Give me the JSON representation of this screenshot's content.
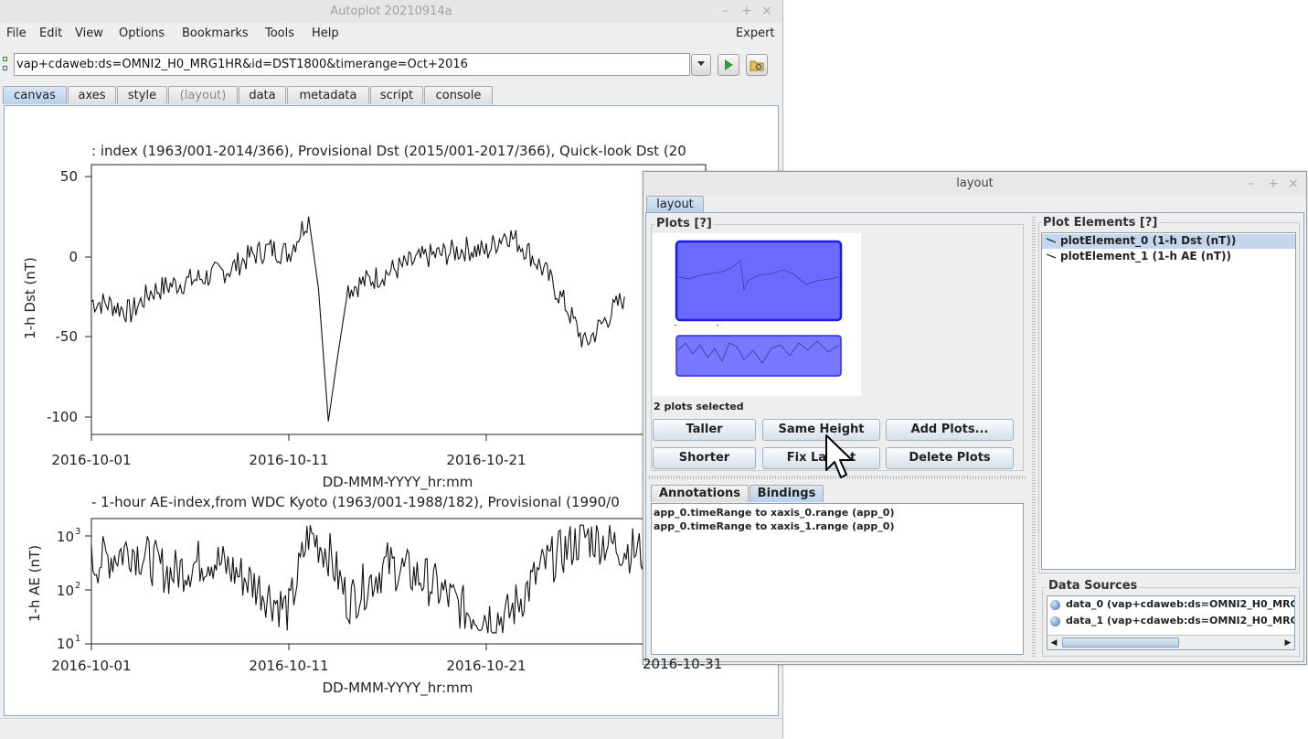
{
  "window": {
    "title": "Autoplot 20210914a",
    "controls": [
      "–",
      "+",
      "×"
    ]
  },
  "menu": {
    "items": [
      "File",
      "Edit",
      "View",
      "Options",
      "Bookmarks",
      "Tools",
      "Help"
    ],
    "expert": "Expert"
  },
  "uri": {
    "value": "vap+cdaweb:ds=OMNI2_H0_MRG1HR&id=DST1800&timerange=Oct+2016"
  },
  "tabs": [
    {
      "label": "canvas",
      "active": true
    },
    {
      "label": "axes"
    },
    {
      "label": "style"
    },
    {
      "label": "(layout)",
      "dim": true
    },
    {
      "label": "data"
    },
    {
      "label": "metadata"
    },
    {
      "label": "script"
    },
    {
      "label": "console"
    }
  ],
  "plots": [
    {
      "title": ": index (1963/001-2014/366), Provisional Dst (2015/001-2017/366), Quick-look Dst (20",
      "ylabel": "1-h Dst (nT)",
      "xlabel": "DD-MMM-YYYY_hr:mm",
      "yticks": [
        "50",
        "0",
        "-50",
        "-100"
      ],
      "xticks": [
        "2016-10-01",
        "2016-10-11",
        "2016-10-21"
      ]
    },
    {
      "title": "- 1-hour AE-index,from WDC Kyoto (1963/001-1988/182), Provisional (1990/0",
      "ylabel": "1-h AE (nT)",
      "xlabel": "DD-MMM-YYYY_hr:mm",
      "yticks": [
        "10",
        "10",
        "10"
      ],
      "yexp": [
        "3",
        "2",
        "1"
      ],
      "xticks": [
        "2016-10-01",
        "2016-10-11",
        "2016-10-21",
        "2016-10-31"
      ]
    }
  ],
  "chart_data": [
    {
      "type": "line",
      "title": ": index (1963/001-2014/366), Provisional Dst (2015/001-2017/366), Quick-look Dst (20",
      "xlabel": "DD-MMM-YYYY_hr:mm",
      "ylabel": "1-h Dst (nT)",
      "xlim": [
        "2016-10-01",
        "2016-10-28"
      ],
      "ylim": [
        -110,
        60
      ],
      "series": [
        {
          "x": [
            "2016-10-01",
            "2016-10-02",
            "2016-10-03",
            "2016-10-04",
            "2016-10-05",
            "2016-10-06",
            "2016-10-07",
            "2016-10-08",
            "2016-10-09",
            "2016-10-10",
            "2016-10-11",
            "2016-10-12",
            "2016-10-12.5",
            "2016-10-13",
            "2016-10-13.5",
            "2016-10-14",
            "2016-10-15",
            "2016-10-16",
            "2016-10-17",
            "2016-10-18",
            "2016-10-19",
            "2016-10-20",
            "2016-10-21",
            "2016-10-22",
            "2016-10-23",
            "2016-10-24",
            "2016-10-25",
            "2016-10-26",
            "2016-10-27",
            "2016-10-28"
          ],
          "y": [
            -28,
            -30,
            -35,
            -22,
            -18,
            -15,
            -12,
            -8,
            0,
            5,
            2,
            25,
            -20,
            -103,
            -60,
            -20,
            -15,
            -10,
            -5,
            0,
            2,
            5,
            3,
            15,
            5,
            -10,
            -30,
            -55,
            -40,
            -25
          ]
        }
      ]
    },
    {
      "type": "line",
      "title": "- 1-hour AE-index,from WDC Kyoto (1963/001-1988/182), Provisional (1990/0",
      "xlabel": "DD-MMM-YYYY_hr:mm",
      "ylabel": "1-h AE (nT)",
      "yscale": "log",
      "xlim": [
        "2016-10-01",
        "2016-10-31"
      ],
      "ylim": [
        10,
        1300
      ],
      "series": [
        {
          "x": [
            "2016-10-01",
            "2016-10-03",
            "2016-10-05",
            "2016-10-07",
            "2016-10-09",
            "2016-10-11",
            "2016-10-12",
            "2016-10-13",
            "2016-10-14",
            "2016-10-16",
            "2016-10-18",
            "2016-10-20",
            "2016-10-22",
            "2016-10-24",
            "2016-10-26",
            "2016-10-28",
            "2016-10-30"
          ],
          "y": [
            300,
            600,
            200,
            400,
            150,
            40,
            1100,
            500,
            60,
            300,
            150,
            40,
            30,
            300,
            1000,
            600,
            400
          ]
        }
      ]
    }
  ],
  "layout_dialog": {
    "title": "layout",
    "tab": "layout",
    "plots_label": "Plots [?]",
    "selected_text": "2 plots selected",
    "buttons": {
      "taller": "Taller",
      "same_height": "Same Height",
      "add_plots": "Add Plots...",
      "shorter": "Shorter",
      "fix_layout": "Fix La",
      "fix_layout_tail": "t",
      "delete_plots": "Delete Plots"
    },
    "sub_tabs": [
      "Annotations",
      "Bindings"
    ],
    "bindings": [
      "app_0.timeRange to xaxis_0.range  (app_0)",
      "app_0.timeRange to xaxis_1.range  (app_0)"
    ],
    "plot_elements_label": "Plot Elements [?]",
    "plot_elements": [
      "plotElement_0 (1-h Dst (nT))",
      "plotElement_1 (1-h AE (nT))"
    ],
    "data_sources_label": "Data Sources",
    "data_sources": [
      "data_0 (vap+cdaweb:ds=OMNI2_H0_MRG1HI",
      "data_1 (vap+cdaweb:ds=OMNI2_H0_MRG1HI"
    ],
    "overlap_tick": "2016-10-31"
  }
}
